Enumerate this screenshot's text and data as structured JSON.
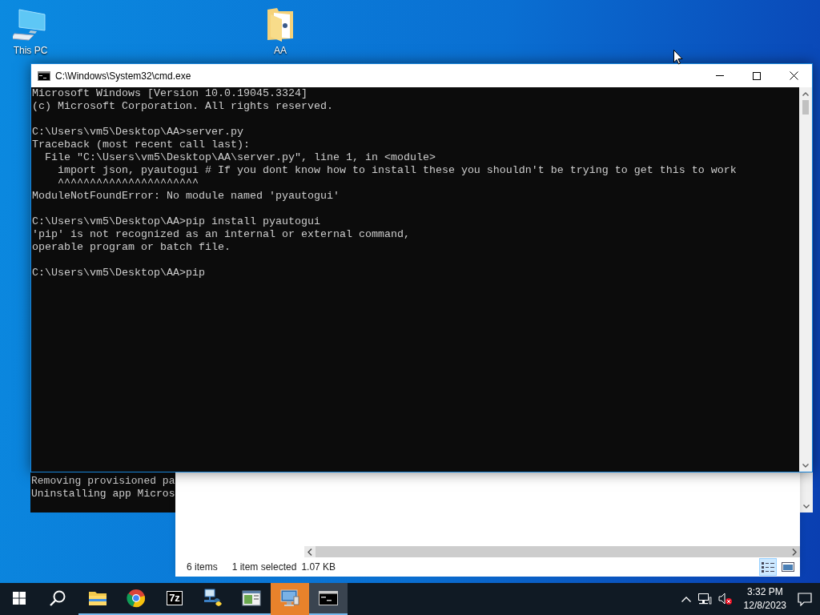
{
  "desktop_icons": [
    {
      "kind": "computer",
      "label": "This PC"
    },
    {
      "kind": "folder",
      "label": "AA"
    }
  ],
  "cmd_window": {
    "title": "C:\\Windows\\System32\\cmd.exe",
    "blocks": [
      [
        "Microsoft Windows [Version 10.0.19045.3324]",
        "(c) Microsoft Corporation. All rights reserved."
      ],
      [
        "C:\\Users\\vm5\\Desktop\\AA>server.py",
        "Traceback (most recent call last):",
        "  File \"C:\\Users\\vm5\\Desktop\\AA\\server.py\", line 1, in <module>",
        "    import json, pyautogui # If you dont know how to install these you shouldn't be trying to get this to work",
        "    ^^^^^^^^^^^^^^^^^^^^^^",
        "ModuleNotFoundError: No module named 'pyautogui'"
      ],
      [
        "C:\\Users\\vm5\\Desktop\\AA>pip install pyautogui",
        "'pip' is not recognized as an internal or external command,",
        "operable program or batch file."
      ],
      [
        "C:\\Users\\vm5\\Desktop\\AA>pip"
      ]
    ]
  },
  "background_console": {
    "lines": [
      "Removing provisioned pa",
      "Uninstalling app Micros"
    ]
  },
  "explorer": {
    "item_count": "6 items",
    "selection": "1 item selected",
    "size": "1.07 KB",
    "view_buttons": [
      {
        "kind": "details",
        "selected": true
      },
      {
        "kind": "thumbnails",
        "selected": false
      }
    ]
  },
  "taskbar": {
    "apps": [
      {
        "kind": "explorer",
        "running": true,
        "selected": false,
        "flashing": false
      },
      {
        "kind": "browser",
        "running": true,
        "selected": false,
        "flashing": false
      },
      {
        "kind": "archiver",
        "label": "7z",
        "running": true,
        "selected": false,
        "flashing": false
      },
      {
        "kind": "network-tool",
        "running": true,
        "selected": false,
        "flashing": false
      },
      {
        "kind": "window-app",
        "running": true,
        "selected": false,
        "flashing": false
      },
      {
        "kind": "monitor-app",
        "running": true,
        "selected": false,
        "flashing": true
      },
      {
        "kind": "terminal",
        "running": true,
        "selected": true,
        "flashing": false
      }
    ],
    "time": "3:32 PM",
    "date": "12/8/2023"
  }
}
